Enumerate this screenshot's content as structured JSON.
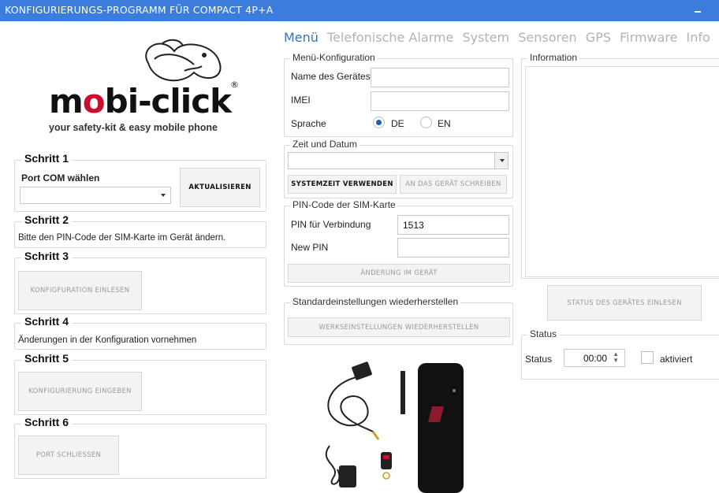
{
  "window": {
    "title": "KONFIGURIERUNGS-PROGRAMM FÜR COMPACT 4P+A"
  },
  "logo": {
    "brand_prefix": "m",
    "brand_o": "o",
    "brand_suffix": "bi-click",
    "registered": "®",
    "tagline": "your safety-kit & easy mobile phone"
  },
  "steps": {
    "s1": {
      "title": "Schritt 1",
      "label": "Port COM wählen",
      "port_value": "",
      "refresh_button": "AKTUALISIEREN"
    },
    "s2": {
      "title": "Schritt 2",
      "text": "Bitte den PIN-Code der SIM-Karte im Gerät ändern."
    },
    "s3": {
      "title": "Schritt 3",
      "button": "KONFIGFURATION EINLESEN"
    },
    "s4": {
      "title": "Schritt 4",
      "text": "Änderungen in der Konfiguration vornehmen"
    },
    "s5": {
      "title": "Schritt 5",
      "button": "KONFIGURIERUNG EINGEBEN"
    },
    "s6": {
      "title": "Schritt 6",
      "button": "PORT SCHLIEßEN"
    }
  },
  "tabs": [
    "Menü",
    "Telefonische Alarme",
    "System",
    "Sensoren",
    "GPS",
    "Firmware",
    "Info"
  ],
  "menu_config": {
    "title": "Menü-Konfiguration",
    "device_name_label": "Name des Gerätes",
    "device_name_value": "",
    "imei_label": "IMEI",
    "imei_value": "",
    "language_label": "Sprache",
    "lang_de": "DE",
    "lang_en": "EN",
    "lang_selected": "DE"
  },
  "datetime": {
    "title": "Zeit und Datum",
    "value": "",
    "system_time_button": "SYSTEMZEIT VERWENDEN",
    "write_device_button": "AN DAS GERÄT SCHREIBEN"
  },
  "pin": {
    "title": "PIN-Code der SIM-Karte",
    "pin_label": "PIN für Verbindung",
    "pin_value": "1513",
    "new_pin_label": "New PIN",
    "new_pin_value": "",
    "change_button": "ÄNDERUNG IM GERÄT"
  },
  "restore": {
    "title": "Standardeinstellungen wiederherstellen",
    "button": "WERKSEINSTELLUNGEN WIEDERHERSTELLEN"
  },
  "information": {
    "title": "Information",
    "read_status_button": "STATUS DES GERÄTES EINLESEN"
  },
  "status": {
    "title": "Status",
    "label": "Status",
    "time_value": "00:00",
    "activated_label": "aktiviert"
  },
  "colors": {
    "titlebar": "#3b7ddd",
    "tab_active": "#2f74c6",
    "logo_accent": "#c8102e"
  }
}
